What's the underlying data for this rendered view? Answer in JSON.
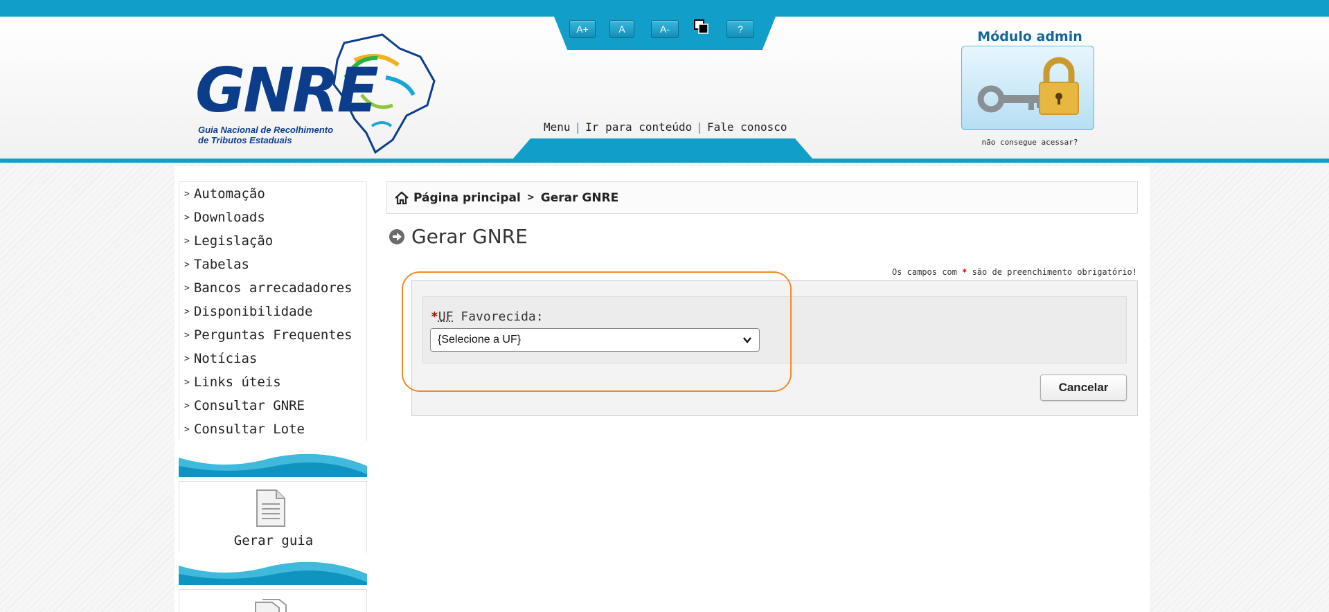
{
  "header": {
    "logo_text": "GNRE",
    "logo_subtitle": "Guia Nacional de Recolhimento\nde Tributos Estaduais",
    "accessibility": [
      "A+",
      "A",
      "A-",
      "?"
    ],
    "links": [
      "Menu",
      "Ir para conteúdo",
      "Fale conosco"
    ],
    "admin_title": "Módulo admin",
    "admin_help": "não consegue acessar?"
  },
  "sidebar": {
    "items": [
      "Automação",
      "Downloads",
      "Legislação",
      "Tabelas",
      "Bancos arrecadadores",
      "Disponibilidade",
      "Perguntas Frequentes",
      "Notícias",
      "Links úteis",
      "Consultar GNRE",
      "Consultar Lote"
    ],
    "card_label": "Gerar guia"
  },
  "breadcrumb": {
    "home": "Página principal",
    "current": "Gerar GNRE"
  },
  "main": {
    "title": "Gerar GNRE",
    "required_note_prefix": "Os campos com",
    "required_star": "*",
    "required_note_suffix": "são de preenchimento obrigatório!",
    "field_abbr": "UF",
    "field_rest": " Favorecida:",
    "select_value": "{Selecione a UF}",
    "cancel_label": "Cancelar"
  },
  "colors": {
    "brand_blue": "#119fc9",
    "logo_navy": "#0c3d8a",
    "highlight": "#f08a24"
  }
}
